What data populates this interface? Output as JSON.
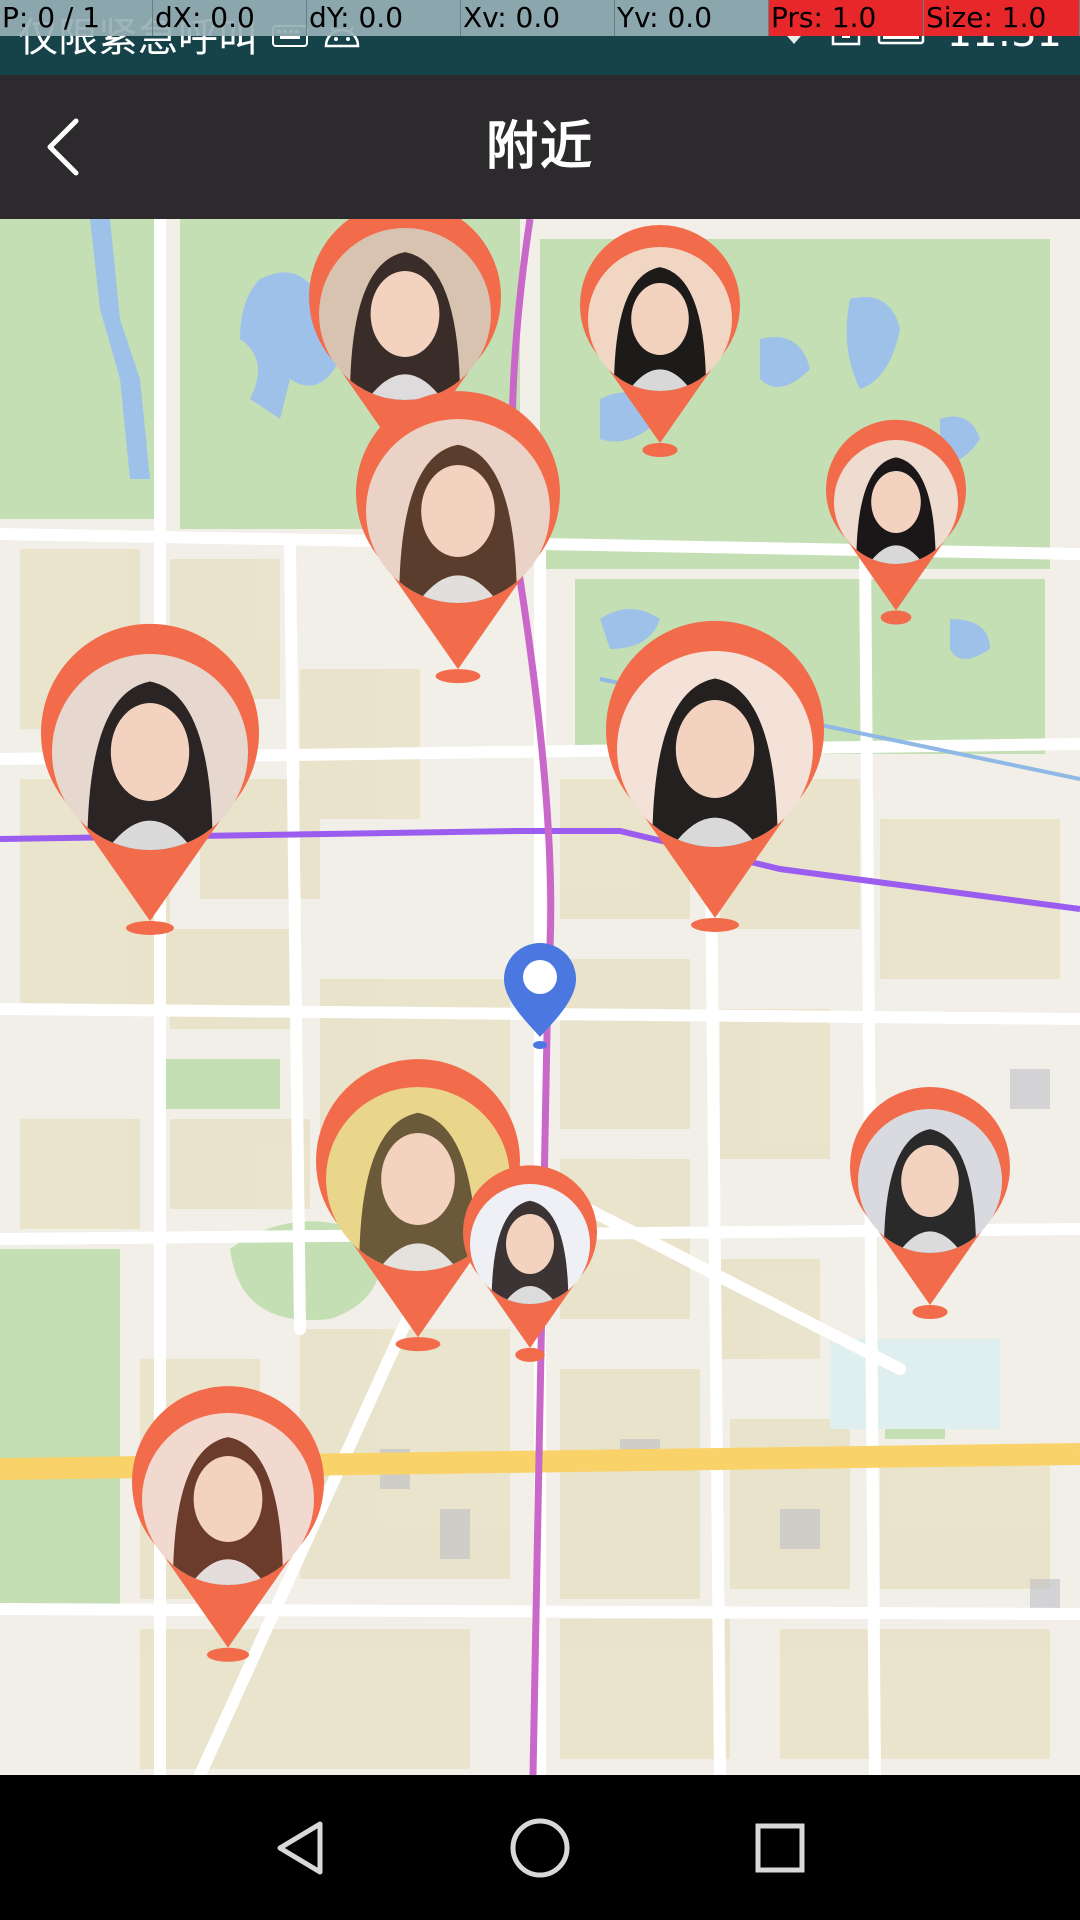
{
  "pointer_debug": {
    "p": "P: 0 / 1",
    "dx": "dX: 0.0",
    "dy": "dY: 0.0",
    "xv": "Xv: 0.0",
    "yv": "Yv: 0.0",
    "prs": "Prs: 1.0",
    "size": "Size: 1.0"
  },
  "status_bar": {
    "carrier": "仅限紧急呼叫",
    "time": "11:31",
    "icons": [
      "keyboard-icon",
      "android-icon",
      "wifi-icon",
      "sim-icon",
      "battery-icon"
    ]
  },
  "app_bar": {
    "title": "附近",
    "back_icon": "chevron-left-icon"
  },
  "map": {
    "pin_color": "#f26b4a",
    "my_location_color": "#4a78e0",
    "road_colors": {
      "metro_purple": "#9b5cf0",
      "rail_magenta": "#c968c8",
      "highway_yellow": "#f9d36a",
      "river_blue": "#9ec1ea",
      "park_green": "#c4dfb4"
    },
    "user_pins": [
      {
        "name": "nearby-user-1"
      },
      {
        "name": "nearby-user-2"
      },
      {
        "name": "nearby-user-3"
      },
      {
        "name": "nearby-user-4"
      },
      {
        "name": "nearby-user-5"
      },
      {
        "name": "nearby-user-6"
      },
      {
        "name": "nearby-user-7"
      },
      {
        "name": "nearby-user-8"
      },
      {
        "name": "nearby-user-9"
      },
      {
        "name": "nearby-user-10"
      }
    ]
  },
  "nav_bar": {
    "back_icon": "triangle-back-icon",
    "home_icon": "circle-home-icon",
    "recents_icon": "square-recents-icon"
  }
}
